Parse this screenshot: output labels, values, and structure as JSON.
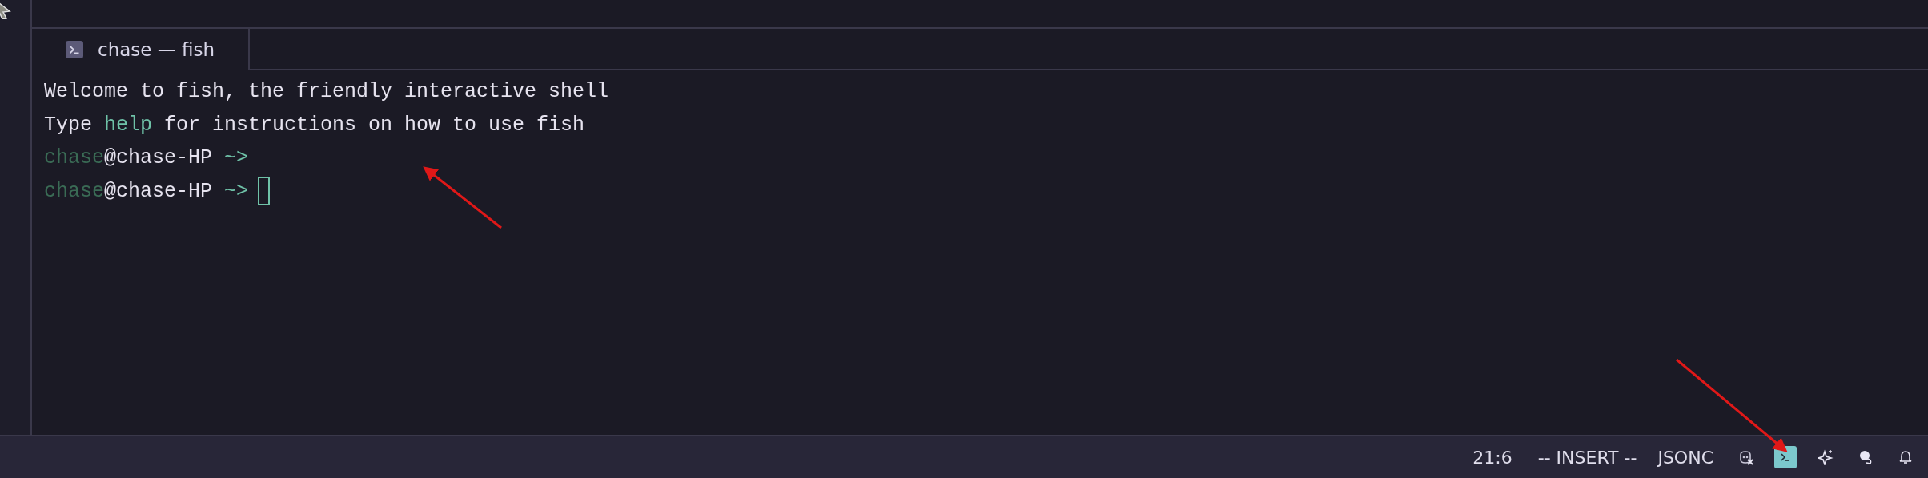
{
  "tabs": [
    {
      "label": "chase — fish",
      "selected": true
    }
  ],
  "terminal": {
    "lines": [
      {
        "segments": [
          {
            "text": "Welcome to fish, the friendly interactive shell",
            "kind": "plain"
          }
        ],
        "cursor": false
      },
      {
        "segments": [
          {
            "text": "Type ",
            "kind": "plain"
          },
          {
            "text": "help",
            "kind": "command"
          },
          {
            "text": " for instructions on how to use fish",
            "kind": "plain"
          }
        ],
        "cursor": false
      },
      {
        "segments": [
          {
            "text": "chase",
            "kind": "user"
          },
          {
            "text": "@chase-HP ",
            "kind": "plain"
          },
          {
            "text": "~>",
            "kind": "cwd"
          }
        ],
        "cursor": false
      },
      {
        "segments": [
          {
            "text": "chase",
            "kind": "user"
          },
          {
            "text": "@chase-HP ",
            "kind": "plain"
          },
          {
            "text": "~>",
            "kind": "cwd"
          }
        ],
        "cursor": true
      }
    ]
  },
  "status_bar": {
    "items": [
      "21:6",
      "-- INSERT --",
      "JSONC"
    ],
    "icons": [
      {
        "kind": "copilot-off",
        "selected": false
      },
      {
        "kind": "terminal",
        "selected": true
      },
      {
        "kind": "sparkle",
        "selected": false
      },
      {
        "kind": "chat",
        "selected": false
      },
      {
        "kind": "bell",
        "selected": false
      }
    ]
  }
}
